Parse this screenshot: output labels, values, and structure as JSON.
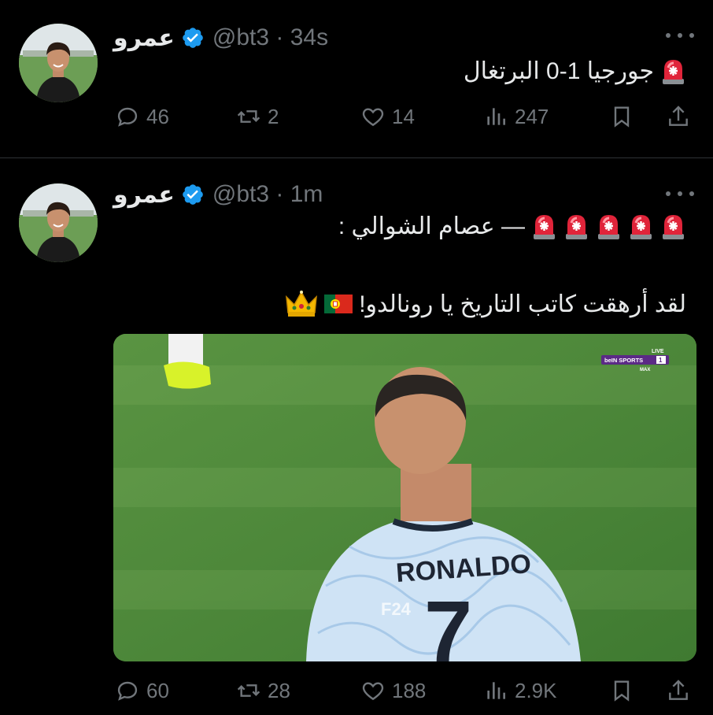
{
  "tweets": [
    {
      "author_name": "عمرو",
      "handle_time": "@bt3 · 34s",
      "text": "جورجيا 1-0 البرتغال",
      "actions": {
        "replies": "46",
        "retweets": "2",
        "likes": "14",
        "views": "247"
      }
    },
    {
      "author_name": "عمرو",
      "handle_time": "@bt3 · 1m",
      "text_line1": "— عصام الشوالي :",
      "text_line2": "لقد أرهقت كاتب التاريخ يا رونالدو!",
      "media": {
        "jersey_name": "RONALDO",
        "jersey_number": "7",
        "watermark": "F24",
        "broadcaster": "beIN SPORTS",
        "live_label": "LIVE",
        "channel": "1",
        "channel_sub": "MAX"
      },
      "actions": {
        "replies": "60",
        "retweets": "28",
        "likes": "188",
        "views": "2.9K"
      }
    }
  ],
  "colors": {
    "background": "#000000",
    "text": "#e7e9ea",
    "muted": "#71767b",
    "verified": "#1d9bf0",
    "divider": "#2f3336",
    "alarm": "#e0243a"
  },
  "icons": [
    "verified-badge-icon",
    "more-icon",
    "alarm-emoji-icon",
    "portugal-flag-icon",
    "crown-emoji-icon",
    "reply-icon",
    "retweet-icon",
    "like-icon",
    "views-icon",
    "bookmark-icon",
    "share-icon"
  ]
}
